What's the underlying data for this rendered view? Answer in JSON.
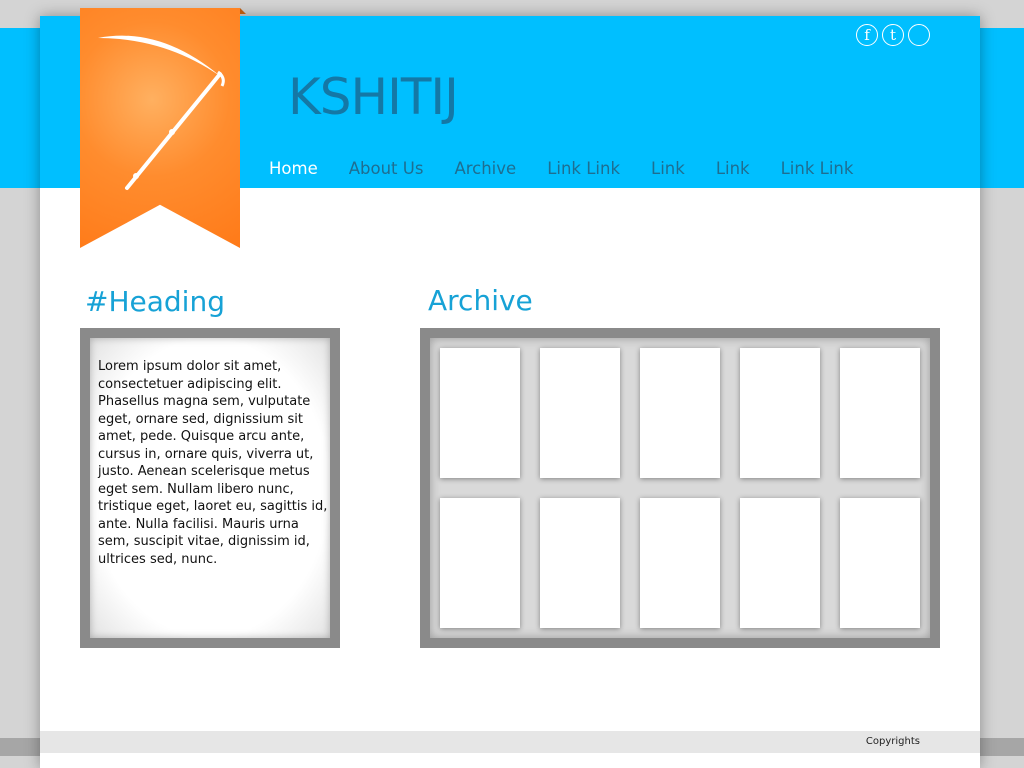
{
  "header": {
    "site_title": "KSHITIJ",
    "social": [
      {
        "glyph": "f",
        "icon": "facebook-icon"
      },
      {
        "glyph": "t",
        "icon": "twitter-icon"
      },
      {
        "glyph": "",
        "icon": "social-icon"
      }
    ],
    "nav": [
      {
        "label": "Home",
        "active": true
      },
      {
        "label": "About Us",
        "active": false
      },
      {
        "label": "Archive",
        "active": false
      },
      {
        "label": "Link Link",
        "active": false
      },
      {
        "label": "Link",
        "active": false
      },
      {
        "label": "Link",
        "active": false
      },
      {
        "label": "Link Link",
        "active": false
      }
    ]
  },
  "left_section": {
    "heading": "#Heading",
    "body": "Lorem ipsum dolor sit amet, consectetuer adipiscing elit. Phasellus magna sem, vulputate eget, ornare sed, dignissium sit amet, pede. Quisque arcu ante, cursus in, ornare quis, viverra ut, justo. Aenean scelerisque metus eget sem. Nullam libero nunc, tristique eget, laoret eu, sagittis id, ante. Nulla facilisi. Mauris urna sem, suscipit vitae, dignissim id, ultrices sed, nunc."
  },
  "archive": {
    "heading": "Archive",
    "card_count": 10
  },
  "footer": {
    "copyright": "Copyrights"
  },
  "colors": {
    "header_blue": "#00bfff",
    "ribbon_orange": "#ff7a18",
    "heading_blue": "#17a2d6",
    "nav_text": "#1e6e91",
    "nav_active": "#ffffff"
  },
  "icons": {
    "logo": "scythe-icon"
  }
}
